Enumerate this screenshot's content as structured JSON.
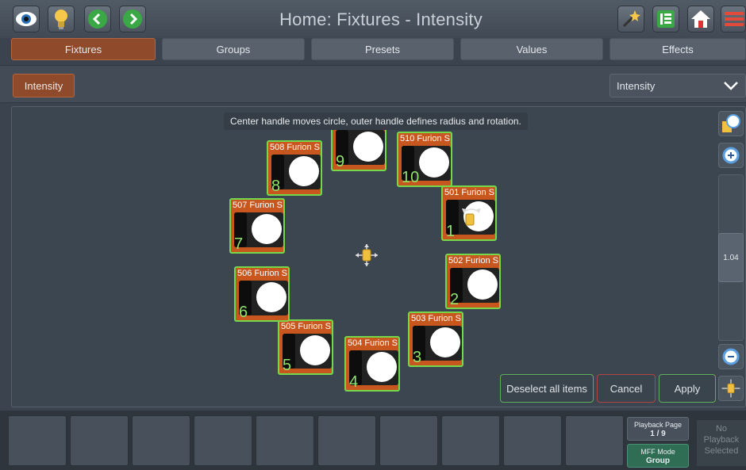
{
  "title": "Home: Fixtures - Intensity",
  "tabs": [
    "Fixtures",
    "Groups",
    "Presets",
    "Values",
    "Effects"
  ],
  "active_tab": "Fixtures",
  "sub": {
    "button_label": "Intensity",
    "select_value": "Intensity"
  },
  "hint": "Center handle moves circle, outer handle defines radius and rotation.",
  "fixtures": [
    {
      "label": "501 Furion S",
      "num": "1"
    },
    {
      "label": "502 Furion S",
      "num": "2"
    },
    {
      "label": "503 Furion S",
      "num": "3"
    },
    {
      "label": "504 Furion S",
      "num": "4"
    },
    {
      "label": "505 Furion S",
      "num": "5"
    },
    {
      "label": "506 Furion S",
      "num": "6"
    },
    {
      "label": "507 Furion S",
      "num": "7"
    },
    {
      "label": "508 Furion S",
      "num": "8"
    },
    {
      "label": "",
      "num": "9"
    },
    {
      "label": "510 Furion S",
      "num": "10"
    }
  ],
  "zoom_value": "1.04",
  "actions": {
    "deselect": "Deselect all items",
    "cancel": "Cancel",
    "apply": "Apply"
  },
  "playback": {
    "page_label": "Playback Page",
    "page_value": "1 / 9",
    "mff_label": "MFF Mode",
    "mff_value": "Group",
    "no_playback_line1": "No",
    "no_playback_line2": "Playback",
    "no_playback_line3": "Selected"
  },
  "colors": {
    "accent": "#c8561f",
    "selected_border": "#74d84a",
    "mff_green": "#2f6e55"
  },
  "icons": [
    "eye-icon",
    "bulb-icon",
    "back-icon",
    "forward-icon",
    "wand-icon",
    "panel-icon",
    "home-icon",
    "menu-icon"
  ]
}
